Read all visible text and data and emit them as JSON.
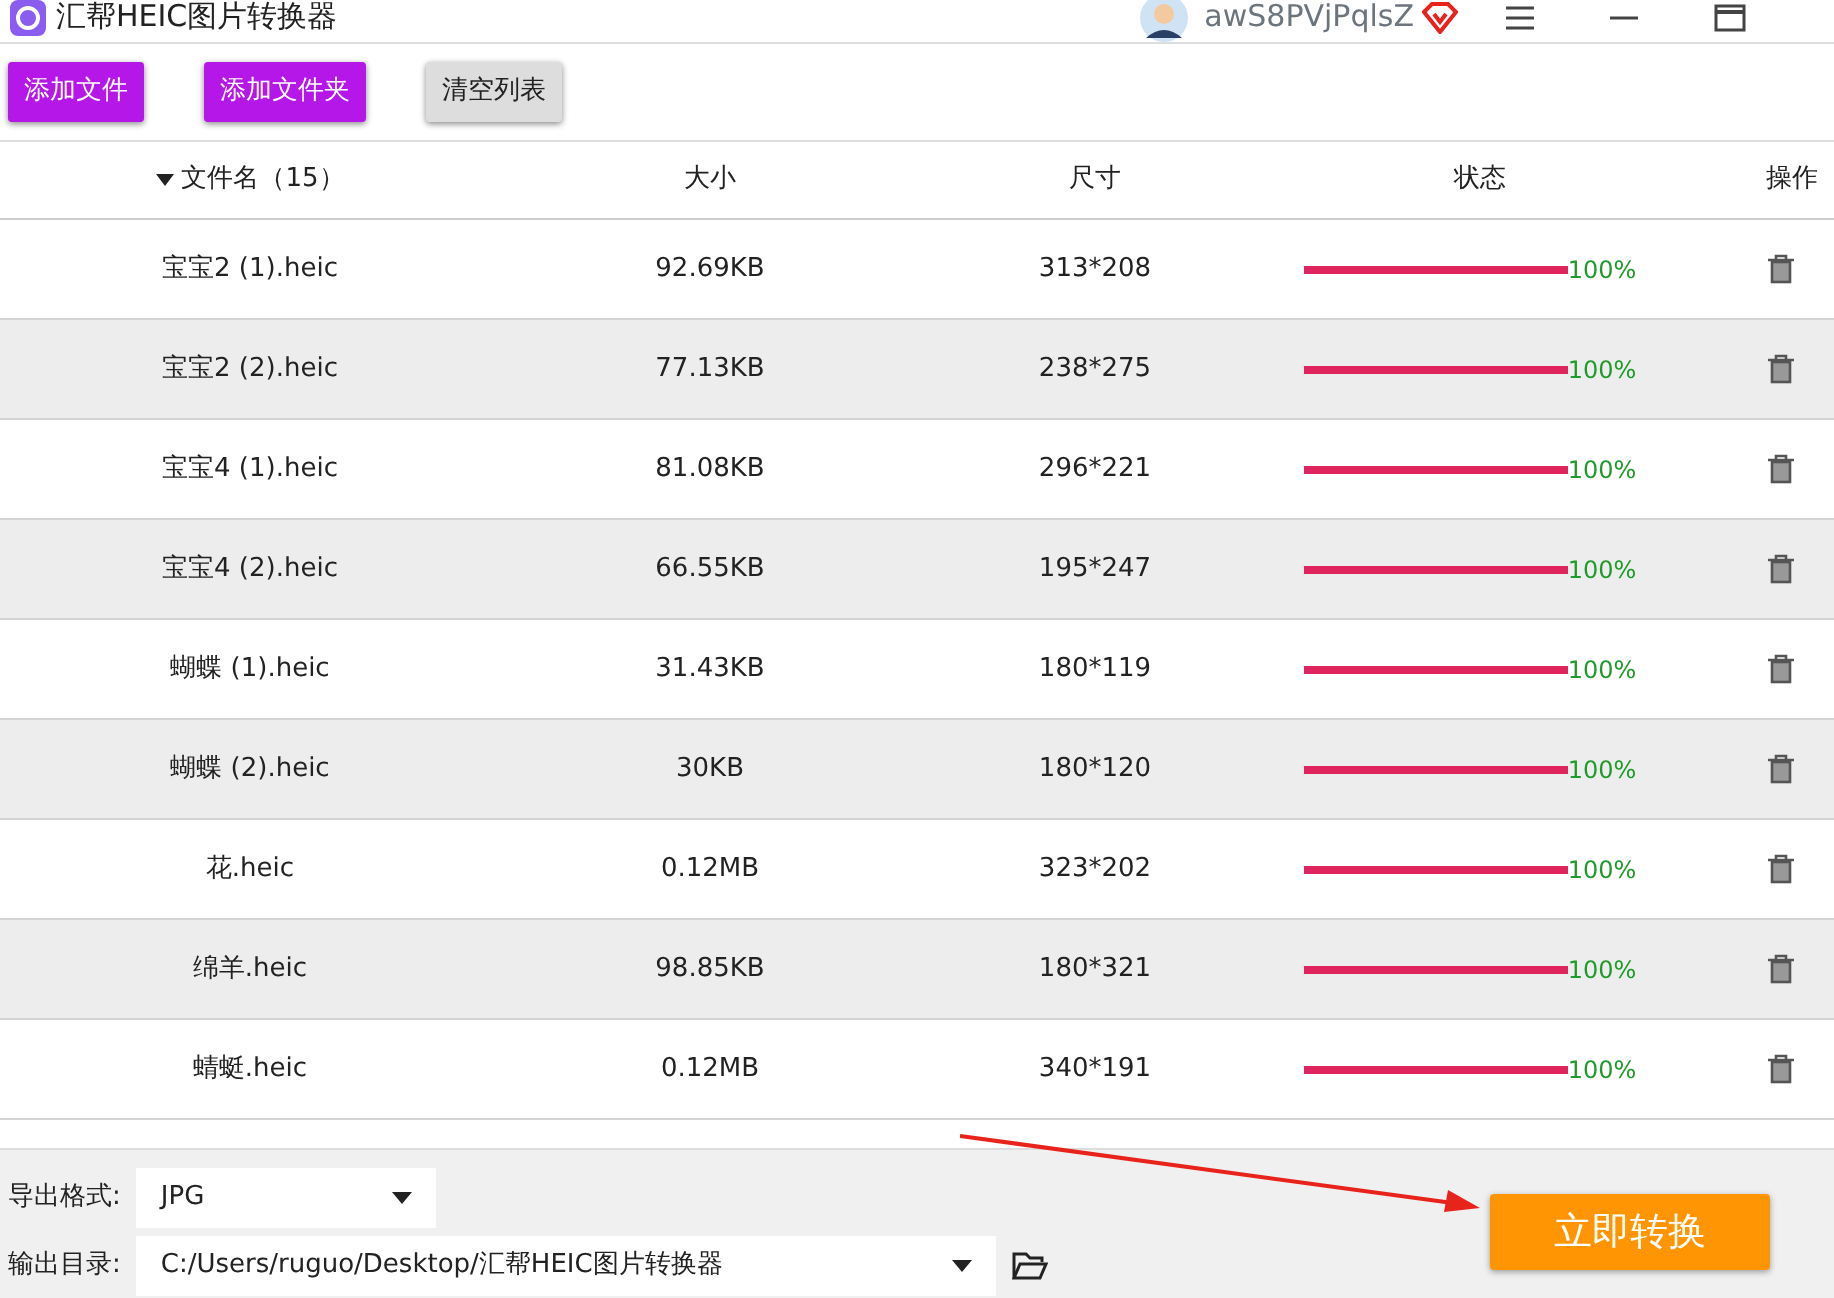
{
  "window": {
    "title": "汇帮HEIC图片转换器",
    "username": "awS8PVjPqlsZ"
  },
  "toolbar": [
    "添加文件",
    "添加文件夹",
    "清空列表"
  ],
  "table": {
    "columns": [
      {
        "label": "文件名（15）",
        "sorted": true
      },
      {
        "label": "大小",
        "sorted": false
      },
      {
        "label": "尺寸",
        "sorted": false
      },
      {
        "label": "状态",
        "sorted": false
      },
      {
        "label": "操作",
        "sorted": false
      }
    ],
    "rows": [
      {
        "name": "宝宝2 (1).heic",
        "size": "92.69KB",
        "dims": "313*208",
        "level": 1,
        "reading": "100%"
      },
      {
        "name": "宝宝2 (2).heic",
        "size": "77.13KB",
        "dims": "238*275",
        "level": 1,
        "reading": "100%"
      },
      {
        "name": "宝宝4 (1).heic",
        "size": "81.08KB",
        "dims": "296*221",
        "level": 1,
        "reading": "100%"
      },
      {
        "name": "宝宝4 (2).heic",
        "size": "66.55KB",
        "dims": "195*247",
        "level": 1,
        "reading": "100%"
      },
      {
        "name": "蝴蝶 (1).heic",
        "size": "31.43KB",
        "dims": "180*119",
        "level": 1,
        "reading": "100%"
      },
      {
        "name": "蝴蝶 (2).heic",
        "size": "30KB",
        "dims": "180*120",
        "level": 1,
        "reading": "100%"
      },
      {
        "name": "花.heic",
        "size": "0.12MB",
        "dims": "323*202",
        "level": 1,
        "reading": "100%"
      },
      {
        "name": "绵羊.heic",
        "size": "98.85KB",
        "dims": "180*321",
        "level": 1,
        "reading": "100%"
      },
      {
        "name": "蜻蜓.heic",
        "size": "0.12MB",
        "dims": "340*191",
        "level": 1,
        "reading": "100%"
      }
    ]
  },
  "output": {
    "format_label": "导出格式:",
    "format": "JPG",
    "dir_label": "输出目录:",
    "dir": "C:/Users/ruguo/Desktop/汇帮HEIC图片转换器",
    "convert": "立即转换"
  }
}
